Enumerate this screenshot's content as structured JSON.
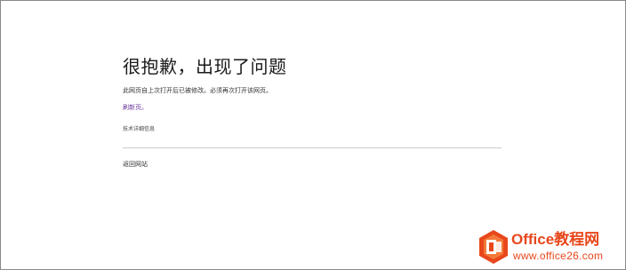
{
  "error_page": {
    "title": "很抱歉，出现了问题",
    "message": "此网页自上次打开后已被修改。必须再次打开该网页。",
    "refresh_link": "刷新页。",
    "technical_details": "技术详细信息",
    "back_link": "返回网站"
  },
  "watermark": {
    "brand": "Office教程网",
    "url": "www.office26.com",
    "logo_icon": "office-logo-icon",
    "accent_color": "#e8471b"
  },
  "colors": {
    "link": "#6b3a9a",
    "title": "#1a1a1a",
    "divider": "#cccccc"
  }
}
